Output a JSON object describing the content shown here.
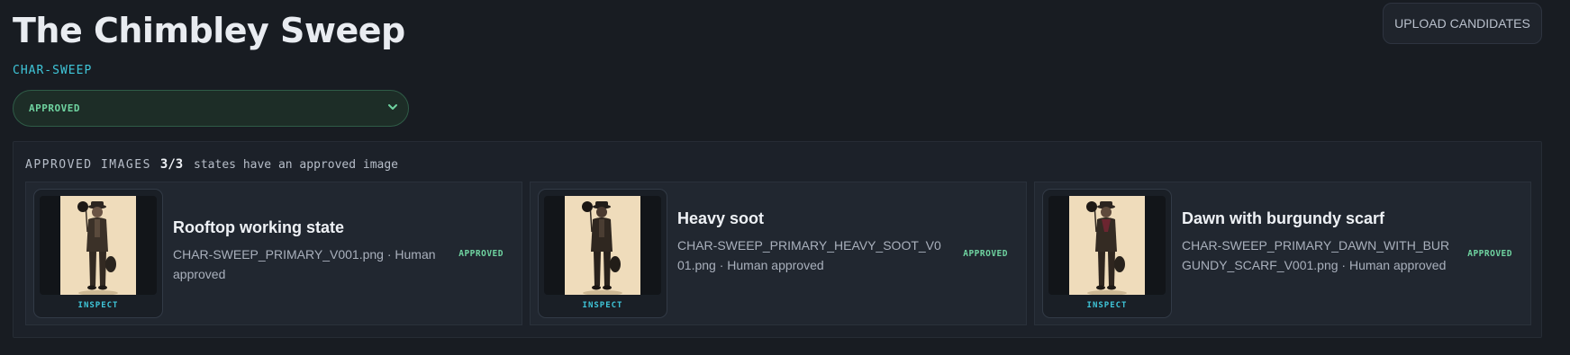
{
  "header": {
    "title": "The Chimbley Sweep",
    "code": "CHAR-SWEEP",
    "status": "APPROVED",
    "upload_label": "UPLOAD CANDIDATES"
  },
  "approved": {
    "label": "APPROVED IMAGES",
    "count": "3/3",
    "summary": "states have an approved image",
    "cards": [
      {
        "title": "Rooftop working state",
        "file": "CHAR-SWEEP_PRIMARY_V001.png · Human approved",
        "badge": "APPROVED",
        "inspect": "INSPECT"
      },
      {
        "title": "Heavy soot",
        "file": "CHAR-SWEEP_PRIMARY_HEAVY_SOOT_V001.png · Human approved",
        "badge": "APPROVED",
        "inspect": "INSPECT"
      },
      {
        "title": "Dawn with burgundy scarf",
        "file": "CHAR-SWEEP_PRIMARY_DAWN_WITH_BURGUNDY_SCARF_V001.png · Human approved",
        "badge": "APPROVED",
        "inspect": "INSPECT"
      }
    ]
  },
  "icons": {
    "select_arrow": "chevron-down-icon"
  },
  "colors": {
    "accent_cyan": "#3fc6d9",
    "approved_green": "#6fd3a0",
    "background": "#181c22"
  }
}
